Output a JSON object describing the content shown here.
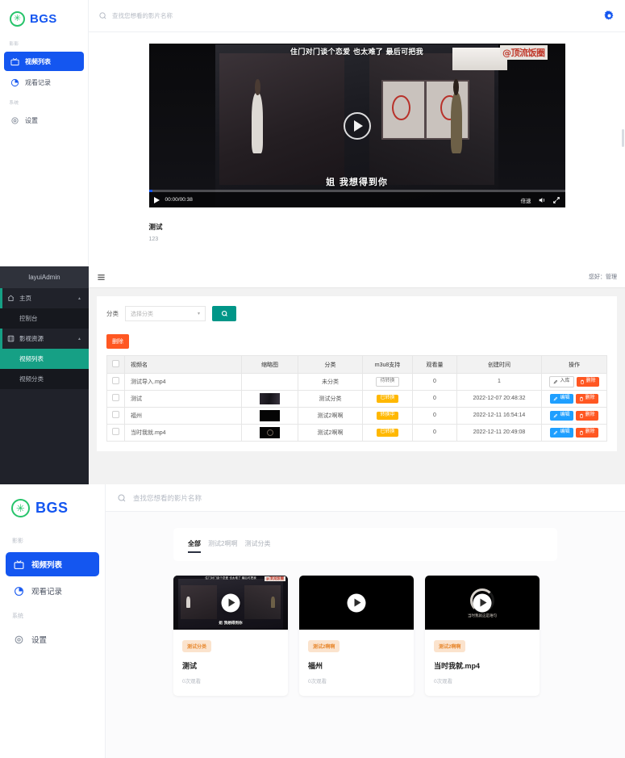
{
  "panel1": {
    "brand": {
      "logo_icon": "asterisk-badge-icon",
      "text": "BGS"
    },
    "search": {
      "icon": "search-icon",
      "placeholder": "查找您想看的影片名称"
    },
    "gear_icon": "gear-icon",
    "sidebar": {
      "caption_media": "影影",
      "caption_system": "系统",
      "items": [
        {
          "label": "视频列表",
          "icon": "tv-icon",
          "active": true
        },
        {
          "label": "观看记录",
          "icon": "clock-pie-icon",
          "active": false
        },
        {
          "label": "设置",
          "icon": "gear-icon",
          "active": false
        }
      ]
    },
    "player": {
      "subtitle_top": "住门对门谈个恋爱 也太难了 最后可把我",
      "subtitle_bottom": "姐 我想得到你",
      "watermark": "@顶流饭圈",
      "play_icon": "play-circle-icon",
      "time": "00:00/00:38",
      "speed_label": "倍速",
      "volume_icon": "volume-icon",
      "fullscreen_icon": "fullscreen-icon",
      "progress_percent": 1
    },
    "video": {
      "title": "测试",
      "description": "123"
    }
  },
  "panel2": {
    "sidebar": {
      "logo": "layuiAdmin",
      "menu": [
        {
          "label": "主页",
          "icon": "home-icon",
          "caret": "▲"
        },
        {
          "label": "控制台",
          "type": "sub"
        },
        {
          "label": "影视资源",
          "icon": "film-icon",
          "caret": "▲"
        },
        {
          "label": "视频列表",
          "type": "sub",
          "selected": true
        },
        {
          "label": "视频分类",
          "type": "sub"
        }
      ]
    },
    "header": {
      "hamburger_icon": "hamburger-icon",
      "greeting": "您好：管理"
    },
    "filter": {
      "label": "分类",
      "select_placeholder": "选择分类",
      "caret": "▾",
      "search_icon": "search-icon"
    },
    "delete_button": "删除",
    "table": {
      "columns": [
        "",
        "视频名",
        "缩略图",
        "分类",
        "m3u8支持",
        "观看量",
        "创建时间",
        "操作"
      ],
      "rows": [
        {
          "name": "测试导入.mp4",
          "thumb": "none",
          "category": "未分类",
          "m3u8": "待转换",
          "m3u8_state": "wait",
          "views": "0",
          "created": "1",
          "action_primary": "入库",
          "action_primary_type": "imp",
          "action_primary_icon": "pencil-icon",
          "action_delete": "删除",
          "action_delete_icon": "trash-icon"
        },
        {
          "name": "测试",
          "thumb": "scene",
          "category": "测试分类",
          "m3u8": "已转换",
          "m3u8_state": "done",
          "views": "0",
          "created": "2022-12-07 20:48:32",
          "action_primary": "编辑",
          "action_primary_type": "edit",
          "action_primary_icon": "pencil-icon",
          "action_delete": "删除",
          "action_delete_icon": "trash-icon"
        },
        {
          "name": "福州",
          "thumb": "black",
          "category": "测试2啊啊",
          "m3u8": "转换中",
          "m3u8_state": "ing",
          "views": "0",
          "created": "2022-12-11 16:54:14",
          "action_primary": "编辑",
          "action_primary_type": "edit",
          "action_primary_icon": "pencil-icon",
          "action_delete": "删除",
          "action_delete_icon": "trash-icon"
        },
        {
          "name": "当时我就.mp4",
          "thumb": "ring",
          "category": "测试2啊啊",
          "m3u8": "已转换",
          "m3u8_state": "done",
          "views": "0",
          "created": "2022-12-11 20:49:08",
          "action_primary": "编辑",
          "action_primary_type": "edit",
          "action_primary_icon": "pencil-icon",
          "action_delete": "删除",
          "action_delete_icon": "trash-icon"
        }
      ]
    }
  },
  "panel3": {
    "brand": {
      "logo_icon": "asterisk-badge-icon",
      "text": "BGS"
    },
    "search": {
      "icon": "search-icon",
      "placeholder": "查找您想看的影片名称"
    },
    "sidebar": {
      "caption_media": "影影",
      "caption_system": "系统",
      "items": [
        {
          "label": "视频列表",
          "icon": "tv-icon",
          "active": true
        },
        {
          "label": "观看记录",
          "icon": "clock-pie-icon",
          "active": false
        },
        {
          "label": "设置",
          "icon": "gear-icon",
          "active": false
        }
      ]
    },
    "tabs": [
      {
        "label": "全部",
        "active": true
      },
      {
        "label": "测试2啊啊",
        "active": false
      },
      {
        "label": "测试分类",
        "active": false
      }
    ],
    "cards": [
      {
        "thumb": "scene",
        "badge": "测试分类",
        "title": "测试",
        "views": "0次观看",
        "play_icon": "play-circle-icon",
        "subtitle_top": "住门对门谈个恋爱 也太难了 最后可把我",
        "subtitle_bottom": "姐 我想得到你",
        "watermark": "@顶流饭圈"
      },
      {
        "thumb": "black",
        "badge": "测试2啊啊",
        "title": "福州",
        "views": "0次观看",
        "play_icon": "play-circle-icon"
      },
      {
        "thumb": "ring",
        "badge": "测试2啊啊",
        "title": "当时我就.mp4",
        "views": "0次观看",
        "play_icon": "play-circle-icon",
        "ring_text": "当时我就这是难句"
      }
    ]
  },
  "colors": {
    "accent_blue": "#1456f0",
    "brand_green": "#27c46b",
    "layui_green": "#16a085",
    "layui_teal": "#009688",
    "orange": "#ff5722",
    "yellow": "#ffb800",
    "edit_blue": "#1e9fff",
    "badge_bg": "#fbe3cd",
    "badge_fg": "#e88b33"
  }
}
